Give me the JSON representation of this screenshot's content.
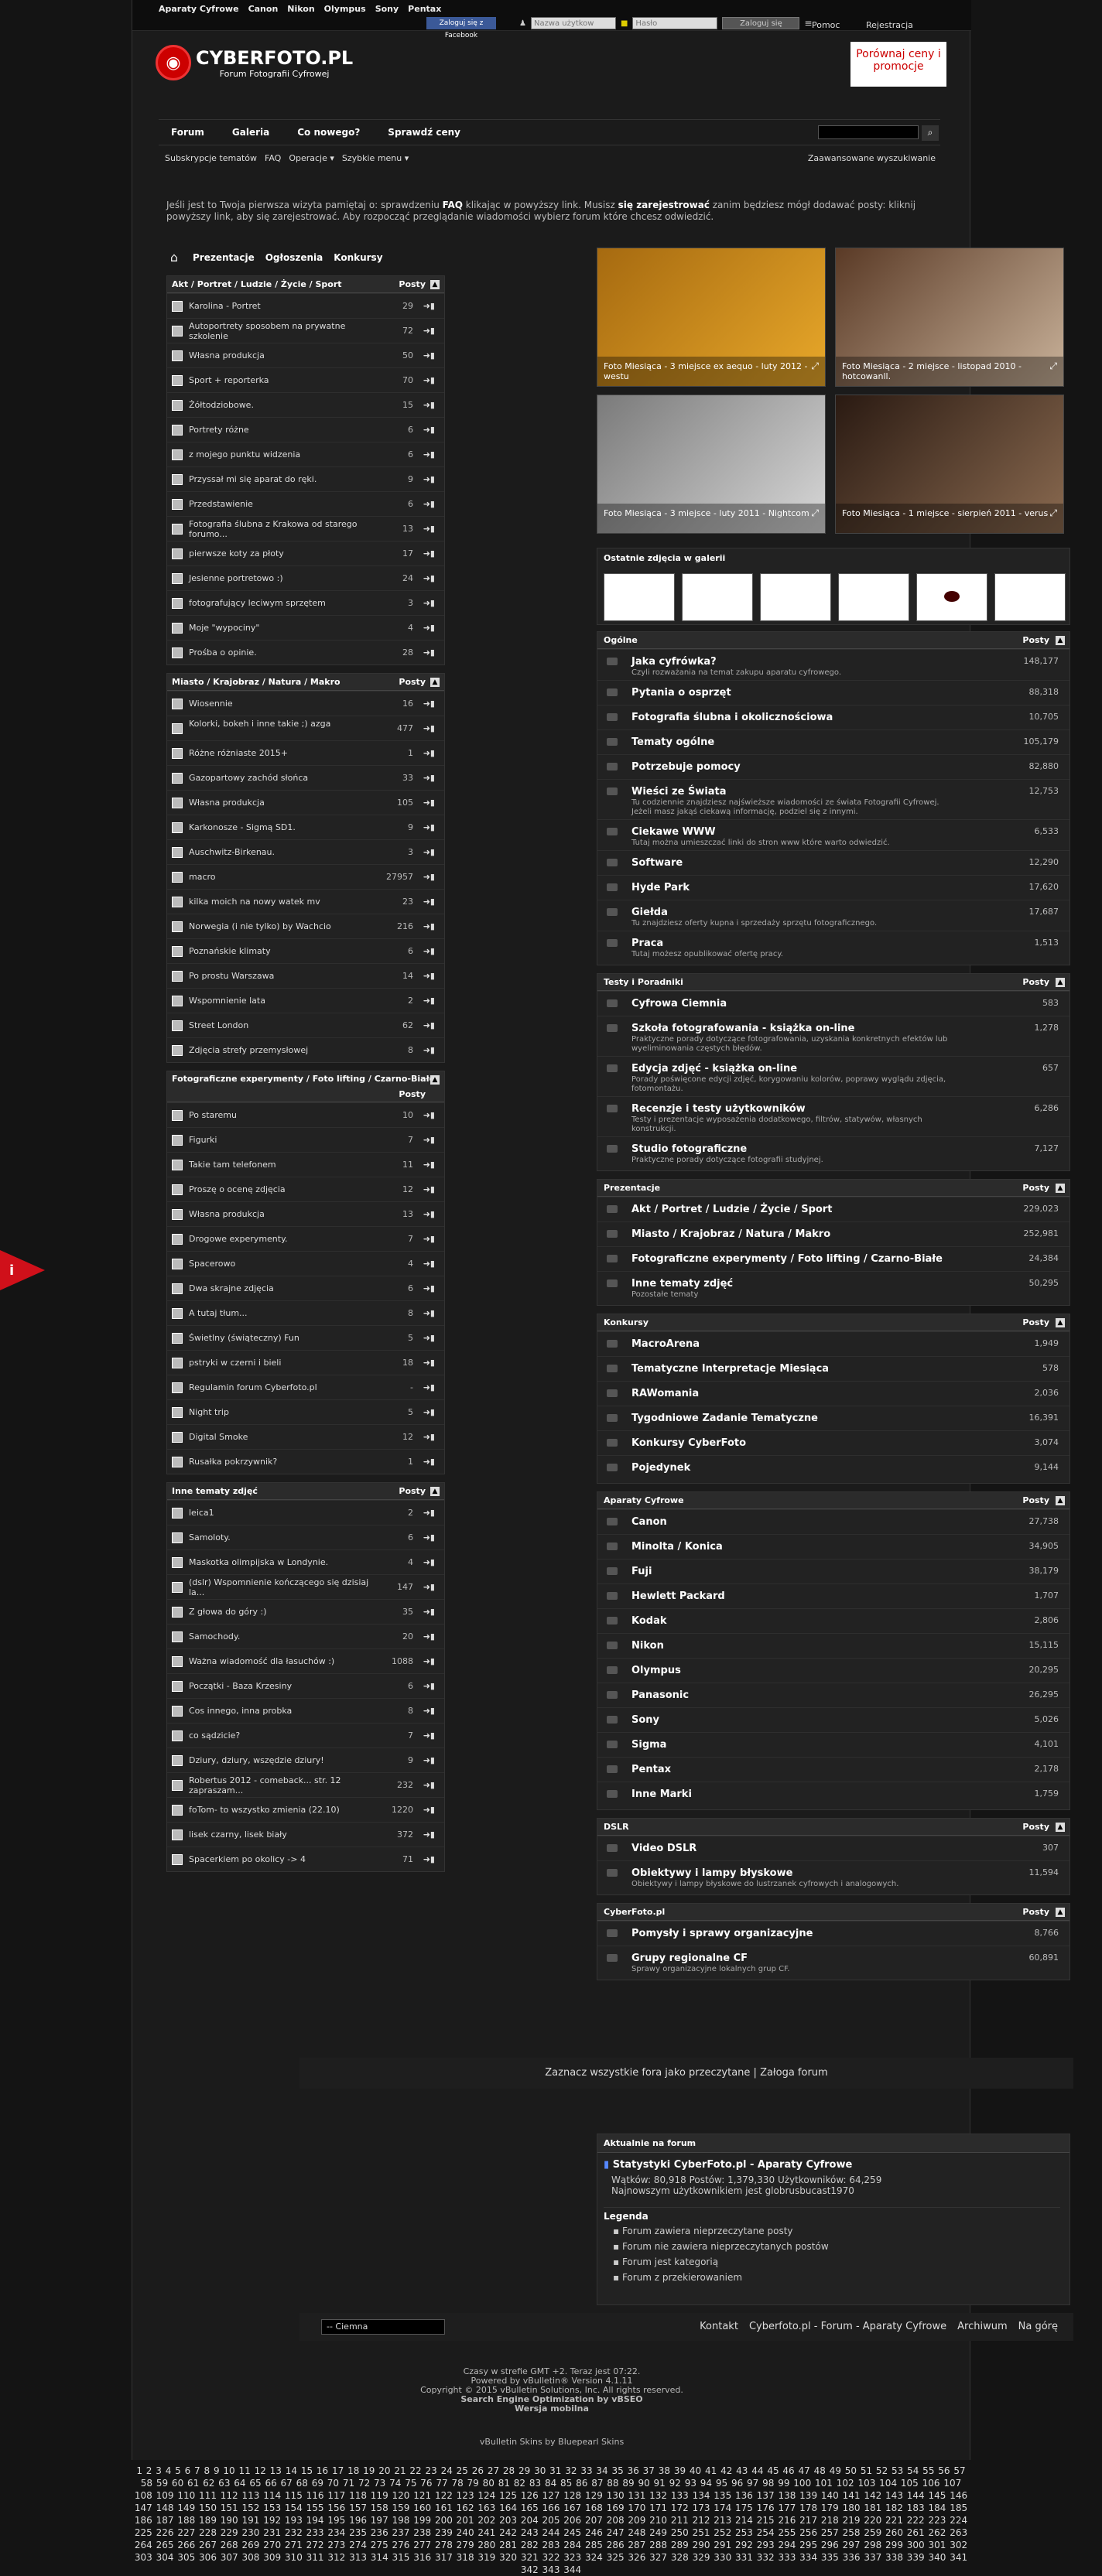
{
  "topbar": {
    "brands": [
      "Aparaty Cyfrowe",
      "Canon",
      "Nikon",
      "Olympus",
      "Sony",
      "Pentax"
    ],
    "fb": "Zaloguj się z Facebook",
    "user_ph": "Nazwa użytkow",
    "pass_ph": "Hasło",
    "login": "Zaloguj się",
    "help": "Pomoc",
    "register": "Rejestracja"
  },
  "logo": {
    "name": "CYBERFOTO.PL",
    "sub": "Forum Fotografii Cyfrowej"
  },
  "ad": "Porównaj ceny i promocje",
  "nav": {
    "items": [
      "Forum",
      "Galeria",
      "Co nowego?",
      "Sprawdź ceny"
    ]
  },
  "subnav": {
    "items": [
      "Subskrypcje tematów",
      "FAQ",
      "Operacje ▾",
      "Szybkie menu ▾"
    ],
    "adv": "Zaawansowane wyszukiwanie"
  },
  "notice": {
    "a": "Jeśli jest to Twoja pierwsza wizyta pamiętaj o: sprawdzeniu ",
    "faq": "FAQ",
    "b": " klikając w powyższy link. Musisz ",
    "reg": "się zarejestrować",
    "c": " zanim będziesz mógł dodawać posty: kliknij powyższy link, aby się zarejestrować. Aby rozpocząć przeglądanie wiadomości wybierz forum które chcesz odwiedzić."
  },
  "tabs": [
    "Prezentacje",
    "Ogłoszenia",
    "Konkursy"
  ],
  "left": [
    {
      "title": "Akt / Portret / Ludzie / Życie / Sport",
      "posts": "Posty",
      "rows": [
        [
          "Karolina - Portret",
          "29"
        ],
        [
          "Autoportrety sposobem na prywatne szkolenie",
          "72"
        ],
        [
          "Własna produkcja",
          "50"
        ],
        [
          "Sport + reporterka",
          "70"
        ],
        [
          "Żółtodziobowe.",
          "15"
        ],
        [
          "Portrety różne",
          "6"
        ],
        [
          "z mojego punktu widzenia",
          "6"
        ],
        [
          "Przyssał mi się aparat do ręki.",
          "9"
        ],
        [
          "Przedstawienie",
          "6"
        ],
        [
          "Fotografia ślubna z Krakowa od starego forumo...",
          "13"
        ],
        [
          "pierwsze koty za płoty",
          "17"
        ],
        [
          "Jesienne portretowo :)",
          "24"
        ],
        [
          "fotografujący leciwym sprzętem",
          "3"
        ],
        [
          "Moje \"wypociny\"",
          "4"
        ],
        [
          "Prośba o opinie.",
          "28"
        ]
      ]
    },
    {
      "title": "Miasto / Krajobraz / Natura / Makro",
      "posts": "Posty",
      "rows": [
        [
          "Wiosennie",
          "16"
        ],
        [
          "Kolorki, bokeh i inne takie ;) azga",
          "477"
        ],
        [
          "Różne różniaste 2015+",
          "1"
        ],
        [
          "Gazopartowy zachód słońca",
          "33"
        ],
        [
          "Własna produkcja",
          "105"
        ],
        [
          "Karkonosze - Sigmą SD1.",
          "9"
        ],
        [
          "Auschwitz-Birkenau.",
          "3"
        ],
        [
          "macro",
          "27957"
        ],
        [
          "kilka moich na nowy watek mv",
          "23"
        ],
        [
          "Norwegia (i nie tylko) by Wachcio",
          "216"
        ],
        [
          "Poznańskie klimaty",
          "6"
        ],
        [
          "Po prostu Warszawa",
          "14"
        ],
        [
          "Wspomnienie lata",
          "2"
        ],
        [
          "Street London",
          "62"
        ],
        [
          "Zdjęcia strefy przemysłowej",
          "8"
        ]
      ]
    },
    {
      "title": "Fotograficzne experymenty / Foto lifting / Czarno-Białe",
      "posts": "Posty",
      "rows": [
        [
          "Po staremu",
          "10"
        ],
        [
          "Figurki",
          "7"
        ],
        [
          "Takie tam telefonem",
          "11"
        ],
        [
          "Proszę o ocenę zdjęcia",
          "12"
        ],
        [
          "Własna produkcja",
          "13"
        ],
        [
          "Drogowe experymenty.",
          "7"
        ],
        [
          "Spacerowo",
          "4"
        ],
        [
          "Dwa skrajne zdjęcia",
          "6"
        ],
        [
          "A tutaj tłum...",
          "8"
        ],
        [
          "Świetlny (świąteczny) Fun",
          "5"
        ],
        [
          "pstryki w czerni i bieli",
          "18"
        ],
        [
          "Regulamin forum Cyberfoto.pl",
          "-"
        ],
        [
          "Night trip",
          "5"
        ],
        [
          "Digital Smoke",
          "12"
        ],
        [
          "Rusałka pokrzywnik?",
          "1"
        ]
      ]
    },
    {
      "title": "Inne tematy zdjęć",
      "posts": "Posty",
      "rows": [
        [
          "leica1",
          "2"
        ],
        [
          "Samoloty.",
          "6"
        ],
        [
          "Maskotka olimpijska w Londynie.",
          "4"
        ],
        [
          "(dslr) Wspomnienie kończącego się dzisiaj la...",
          "147"
        ],
        [
          "Z głowa do góry :)",
          "35"
        ],
        [
          "Samochody.",
          "20"
        ],
        [
          "Ważna wiadomość dla łasuchów :)",
          "1088"
        ],
        [
          "Początki - Baza Krzesiny",
          "6"
        ],
        [
          "Cos innego, inna probka",
          "8"
        ],
        [
          "co sądzicie?",
          "7"
        ],
        [
          "Dziury, dziury, wszędzie dziury!",
          "9"
        ],
        [
          "Robertus 2012 - comeback... str. 12 zapraszam...",
          "232"
        ],
        [
          "foTom- to wszystko zmienia (22.10)",
          "1220"
        ],
        [
          "lisek czarny, lisek biały",
          "372"
        ],
        [
          "Spacerkiem po okolicy -> 4",
          "71"
        ]
      ]
    }
  ],
  "photos": [
    {
      "cap": "Foto Miesiąca - 3 miejsce ex aequo - luty 2012 - westu",
      "c1": "#a66a10",
      "c2": "#e8a82a"
    },
    {
      "cap": "Foto Miesiąca - 2 miejsce - listopad 2010 - hotcowanll.",
      "c1": "#5a3a26",
      "c2": "#c9b29a"
    },
    {
      "cap": "Foto Miesiąca - 3 miejsce - luty 2011 - Nightcom",
      "c1": "#7a7a7a",
      "c2": "#d8d8d8"
    },
    {
      "cap": "Foto Miesiąca - 1 miejsce - sierpień 2011 - verus",
      "c1": "#2a1a12",
      "c2": "#8a6a50"
    }
  ],
  "gallery": {
    "title": "Ostatnie zdjęcia w galerii"
  },
  "sections": [
    {
      "title": "Ogólne",
      "posts": "Posty",
      "rows": [
        [
          "Jaka cyfrówka?",
          "Czyli rozważania na temat zakupu aparatu cyfrowego.",
          "148,177"
        ],
        [
          "Pytania o osprzęt",
          "",
          "88,318"
        ],
        [
          "Fotografia ślubna i okolicznościowa",
          "",
          "10,705"
        ],
        [
          "Tematy ogólne",
          "",
          "105,179"
        ],
        [
          "Potrzebuje pomocy",
          "",
          "82,880"
        ],
        [
          "Wieści ze Świata",
          "Tu codziennie znajdziesz najświeższe wiadomości ze świata Fotografii Cyfrowej. Jeżeli masz jakąś ciekawą informację, podziel się z innymi.",
          "12,753"
        ],
        [
          "Ciekawe WWW",
          "Tutaj można umieszczać linki do stron www które warto odwiedzić.",
          "6,533"
        ],
        [
          "Software",
          "",
          "12,290"
        ],
        [
          "Hyde Park",
          "",
          "17,620"
        ],
        [
          "Giełda",
          "Tu znajdziesz oferty kupna i sprzedaży sprzętu fotograficznego.",
          "17,687"
        ],
        [
          "Praca",
          "Tutaj możesz opublikować ofertę pracy.",
          "1,513"
        ]
      ]
    },
    {
      "title": "Testy i Poradniki",
      "posts": "Posty",
      "rows": [
        [
          "Cyfrowa Ciemnia",
          "",
          "583"
        ],
        [
          "Szkoła fotografowania - książka on-line",
          "Praktyczne porady dotyczące fotografowania, uzyskania konkretnych efektów lub wyeliminowania częstych błędów.",
          "1,278"
        ],
        [
          "Edycja zdjęć - książka on-line",
          "Porady poświęcone edycji zdjęć, korygowaniu kolorów, poprawy wyglądu zdjęcia, fotomontażu.",
          "657"
        ],
        [
          "Recenzje i testy użytkowników",
          "Testy i prezentacje wyposażenia dodatkowego, filtrów, statywów, własnych konstrukcji.",
          "6,286"
        ],
        [
          "Studio fotograficzne",
          "Praktyczne porady dotyczące fotografii studyjnej.",
          "7,127"
        ]
      ]
    },
    {
      "title": "Prezentacje",
      "posts": "Posty",
      "rows": [
        [
          "Akt / Portret / Ludzie / Życie / Sport",
          "",
          "229,023"
        ],
        [
          "Miasto / Krajobraz / Natura / Makro",
          "",
          "252,981"
        ],
        [
          "Fotograficzne experymenty / Foto lifting / Czarno-Białe",
          "",
          "24,384"
        ],
        [
          "Inne tematy zdjęć",
          "Pozostałe tematy",
          "50,295"
        ]
      ]
    },
    {
      "title": "Konkursy",
      "posts": "Posty",
      "rows": [
        [
          "MacroArena",
          "",
          "1,949"
        ],
        [
          "Tematyczne Interpretacje Miesiąca",
          "",
          "578"
        ],
        [
          "RAWomania",
          "",
          "2,036"
        ],
        [
          "Tygodniowe Zadanie Tematyczne",
          "",
          "16,391"
        ],
        [
          "Konkursy CyberFoto",
          "",
          "3,074"
        ],
        [
          "Pojedynek",
          "",
          "9,144"
        ]
      ]
    },
    {
      "title": "Aparaty Cyfrowe",
      "posts": "Posty",
      "rows": [
        [
          "Canon",
          "",
          "27,738"
        ],
        [
          "Minolta / Konica",
          "",
          "34,905"
        ],
        [
          "Fuji",
          "",
          "38,179"
        ],
        [
          "Hewlett Packard",
          "",
          "1,707"
        ],
        [
          "Kodak",
          "",
          "2,806"
        ],
        [
          "Nikon",
          "",
          "15,115"
        ],
        [
          "Olympus",
          "",
          "20,295"
        ],
        [
          "Panasonic",
          "",
          "26,295"
        ],
        [
          "Sony",
          "",
          "5,026"
        ],
        [
          "Sigma",
          "",
          "4,101"
        ],
        [
          "Pentax",
          "",
          "2,178"
        ],
        [
          "Inne Marki",
          "",
          "1,759"
        ]
      ]
    },
    {
      "title": "DSLR",
      "posts": "Posty",
      "rows": [
        [
          "Video DSLR",
          "",
          "307"
        ],
        [
          "Obiektywy i lampy błyskowe",
          "Obiektywy i lampy błyskowe do lustrzanek cyfrowych i analogowych.",
          "11,594"
        ]
      ]
    },
    {
      "title": "CyberFoto.pl",
      "posts": "Posty",
      "rows": [
        [
          "Pomysły i sprawy organizacyjne",
          "",
          "8,766"
        ],
        [
          "Grupy regionalne CF",
          "Sprawy organizacyjne lokalnych grup CF.",
          "60,891"
        ]
      ]
    }
  ],
  "mark": "Zaznacz wszystkie fora jako przeczytane  |  Załoga forum",
  "stats": {
    "head": "Aktualnie na forum",
    "title": "Statystyki CyberFoto.pl - Aparaty Cyfrowe",
    "line1": "Wątków: 80,918  Postów: 1,379,330  Użytkowników: 64,259",
    "line2": "Najnowszym użytkownikiem jest globrusbucast1970",
    "legend": "Legenda",
    "items": [
      "Forum zawiera nieprzeczytane posty",
      "Forum nie zawiera nieprzeczytanych postów",
      "Forum jest kategorią",
      "Forum z przekierowaniem"
    ]
  },
  "footer": {
    "style": "-- Ciemna",
    "links": [
      "Kontakt",
      "Cyberfoto.pl - Forum - Aparaty Cyfrowe",
      "Archiwum",
      "Na górę"
    ]
  },
  "legal": [
    "Czasy w strefie GMT +2. Teraz jest 07:22.",
    "",
    "Powered by vBulletin® Version 4.1.11",
    "Copyright © 2015 vBulletin Solutions, Inc. All rights reserved.",
    "Search Engine Optimization by vBSEO",
    "Wersja mobilna"
  ],
  "skin": "vBulletin Skins by Bluepearl Skins",
  "pager": "1 2 3 4 5 6 7 8 9 10 11 12 13 14 15 16 17 18 19 20 21 22 23 24 25 26 27 28 29 30 31 32 33 34 35 36 37 38 39 40 41 42 43 44 45 46 47 48 49 50 51 52 53 54 55 56 57 58 59 60 61 62 63 64 65 66 67 68 69 70 71 72 73 74 75 76 77 78 79 80 81 82 83 84 85 86 87 88 89 90 91 92 93 94 95 96 97 98 99 100 101 102 103 104 105 106 107 108 109 110 111 112 113 114 115 116 117 118 119 120 121 122 123 124 125 126 127 128 129 130 131 132 133 134 135 136 137 138 139 140 141 142 143 144 145 146 147 148 149 150 151 152 153 154 155 156 157 158 159 160 161 162 163 164 165 166 167 168 169 170 171 172 173 174 175 176 177 178 179 180 181 182 183 184 185 186 187 188 189 190 191 192 193 194 195 196 197 198 199 200 201 202 203 204 205 206 207 208 209 210 211 212 213 214 215 216 217 218 219 220 221 222 223 224 225 226 227 228 229 230 231 232 233 234 235 236 237 238 239 240 241 242 243 244 245 246 247 248 249 250 251 252 253 254 255 256 257 258 259 260 261 262 263 264 265 266 267 268 269 270 271 272 273 274 275 276 277 278 279 280 281 282 283 284 285 286 287 288 289 290 291 292 293 294 295 296 297 298 299 300 301 302 303 304 305 306 307 308 309 310 311 312 313 314 315 316 317 318 319 320 321 322 323 324 325 326 327 328 329 330 331 332 333 334 335 336 337 338 339 340 341 342 343 344"
}
